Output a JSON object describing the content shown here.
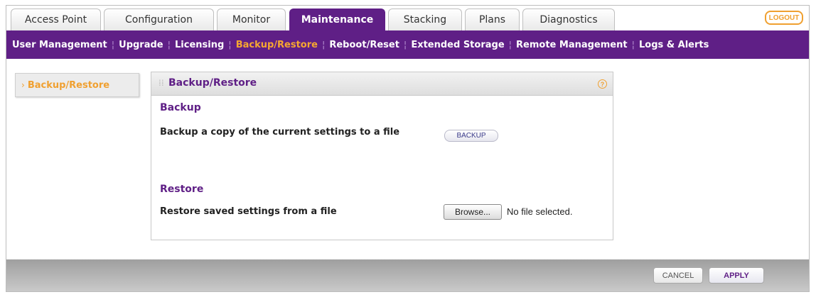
{
  "tabs": [
    {
      "label": "Access Point",
      "active": false
    },
    {
      "label": "Configuration",
      "active": false
    },
    {
      "label": "Monitor",
      "active": false
    },
    {
      "label": "Maintenance",
      "active": true
    },
    {
      "label": "Stacking",
      "active": false
    },
    {
      "label": "Plans",
      "active": false
    },
    {
      "label": "Diagnostics",
      "active": false
    }
  ],
  "logout_label": "LOGOUT",
  "subnav": [
    {
      "label": "User Management",
      "active": false
    },
    {
      "label": "Upgrade",
      "active": false
    },
    {
      "label": "Licensing",
      "active": false
    },
    {
      "label": "Backup/Restore",
      "active": true
    },
    {
      "label": "Reboot/Reset",
      "active": false
    },
    {
      "label": "Extended Storage",
      "active": false
    },
    {
      "label": "Remote Management",
      "active": false
    },
    {
      "label": "Logs & Alerts",
      "active": false
    }
  ],
  "leftnav": {
    "arrow": "›",
    "label": "Backup/Restore"
  },
  "panel": {
    "title": "Backup/Restore",
    "help_symbol": "?",
    "backup": {
      "heading": "Backup",
      "label": "Backup a copy of the current settings to a file",
      "button": "BACKUP"
    },
    "restore": {
      "heading": "Restore",
      "label": "Restore saved settings from a file",
      "browse_button": "Browse...",
      "file_status": "No file selected."
    }
  },
  "footer": {
    "cancel": "CANCEL",
    "apply": "APPLY"
  },
  "colors": {
    "brand_purple": "#5f1f86",
    "accent_orange": "#f0a030"
  }
}
